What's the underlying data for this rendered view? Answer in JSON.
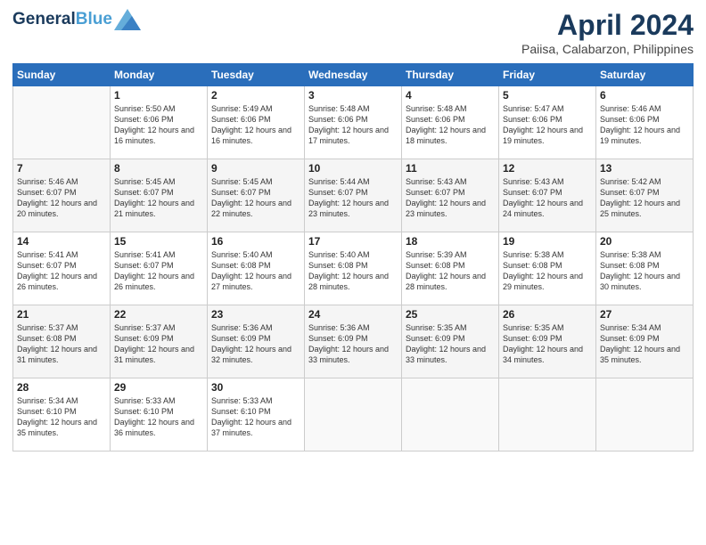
{
  "header": {
    "logo_line1": "General",
    "logo_line2": "Blue",
    "month_title": "April 2024",
    "location": "Paiisa, Calabarzon, Philippines"
  },
  "weekdays": [
    "Sunday",
    "Monday",
    "Tuesday",
    "Wednesday",
    "Thursday",
    "Friday",
    "Saturday"
  ],
  "weeks": [
    [
      {
        "day": "",
        "sunrise": "",
        "sunset": "",
        "daylight": ""
      },
      {
        "day": "1",
        "sunrise": "Sunrise: 5:50 AM",
        "sunset": "Sunset: 6:06 PM",
        "daylight": "Daylight: 12 hours and 16 minutes."
      },
      {
        "day": "2",
        "sunrise": "Sunrise: 5:49 AM",
        "sunset": "Sunset: 6:06 PM",
        "daylight": "Daylight: 12 hours and 16 minutes."
      },
      {
        "day": "3",
        "sunrise": "Sunrise: 5:48 AM",
        "sunset": "Sunset: 6:06 PM",
        "daylight": "Daylight: 12 hours and 17 minutes."
      },
      {
        "day": "4",
        "sunrise": "Sunrise: 5:48 AM",
        "sunset": "Sunset: 6:06 PM",
        "daylight": "Daylight: 12 hours and 18 minutes."
      },
      {
        "day": "5",
        "sunrise": "Sunrise: 5:47 AM",
        "sunset": "Sunset: 6:06 PM",
        "daylight": "Daylight: 12 hours and 19 minutes."
      },
      {
        "day": "6",
        "sunrise": "Sunrise: 5:46 AM",
        "sunset": "Sunset: 6:06 PM",
        "daylight": "Daylight: 12 hours and 19 minutes."
      }
    ],
    [
      {
        "day": "7",
        "sunrise": "Sunrise: 5:46 AM",
        "sunset": "Sunset: 6:07 PM",
        "daylight": "Daylight: 12 hours and 20 minutes."
      },
      {
        "day": "8",
        "sunrise": "Sunrise: 5:45 AM",
        "sunset": "Sunset: 6:07 PM",
        "daylight": "Daylight: 12 hours and 21 minutes."
      },
      {
        "day": "9",
        "sunrise": "Sunrise: 5:45 AM",
        "sunset": "Sunset: 6:07 PM",
        "daylight": "Daylight: 12 hours and 22 minutes."
      },
      {
        "day": "10",
        "sunrise": "Sunrise: 5:44 AM",
        "sunset": "Sunset: 6:07 PM",
        "daylight": "Daylight: 12 hours and 23 minutes."
      },
      {
        "day": "11",
        "sunrise": "Sunrise: 5:43 AM",
        "sunset": "Sunset: 6:07 PM",
        "daylight": "Daylight: 12 hours and 23 minutes."
      },
      {
        "day": "12",
        "sunrise": "Sunrise: 5:43 AM",
        "sunset": "Sunset: 6:07 PM",
        "daylight": "Daylight: 12 hours and 24 minutes."
      },
      {
        "day": "13",
        "sunrise": "Sunrise: 5:42 AM",
        "sunset": "Sunset: 6:07 PM",
        "daylight": "Daylight: 12 hours and 25 minutes."
      }
    ],
    [
      {
        "day": "14",
        "sunrise": "Sunrise: 5:41 AM",
        "sunset": "Sunset: 6:07 PM",
        "daylight": "Daylight: 12 hours and 26 minutes."
      },
      {
        "day": "15",
        "sunrise": "Sunrise: 5:41 AM",
        "sunset": "Sunset: 6:07 PM",
        "daylight": "Daylight: 12 hours and 26 minutes."
      },
      {
        "day": "16",
        "sunrise": "Sunrise: 5:40 AM",
        "sunset": "Sunset: 6:08 PM",
        "daylight": "Daylight: 12 hours and 27 minutes."
      },
      {
        "day": "17",
        "sunrise": "Sunrise: 5:40 AM",
        "sunset": "Sunset: 6:08 PM",
        "daylight": "Daylight: 12 hours and 28 minutes."
      },
      {
        "day": "18",
        "sunrise": "Sunrise: 5:39 AM",
        "sunset": "Sunset: 6:08 PM",
        "daylight": "Daylight: 12 hours and 28 minutes."
      },
      {
        "day": "19",
        "sunrise": "Sunrise: 5:38 AM",
        "sunset": "Sunset: 6:08 PM",
        "daylight": "Daylight: 12 hours and 29 minutes."
      },
      {
        "day": "20",
        "sunrise": "Sunrise: 5:38 AM",
        "sunset": "Sunset: 6:08 PM",
        "daylight": "Daylight: 12 hours and 30 minutes."
      }
    ],
    [
      {
        "day": "21",
        "sunrise": "Sunrise: 5:37 AM",
        "sunset": "Sunset: 6:08 PM",
        "daylight": "Daylight: 12 hours and 31 minutes."
      },
      {
        "day": "22",
        "sunrise": "Sunrise: 5:37 AM",
        "sunset": "Sunset: 6:09 PM",
        "daylight": "Daylight: 12 hours and 31 minutes."
      },
      {
        "day": "23",
        "sunrise": "Sunrise: 5:36 AM",
        "sunset": "Sunset: 6:09 PM",
        "daylight": "Daylight: 12 hours and 32 minutes."
      },
      {
        "day": "24",
        "sunrise": "Sunrise: 5:36 AM",
        "sunset": "Sunset: 6:09 PM",
        "daylight": "Daylight: 12 hours and 33 minutes."
      },
      {
        "day": "25",
        "sunrise": "Sunrise: 5:35 AM",
        "sunset": "Sunset: 6:09 PM",
        "daylight": "Daylight: 12 hours and 33 minutes."
      },
      {
        "day": "26",
        "sunrise": "Sunrise: 5:35 AM",
        "sunset": "Sunset: 6:09 PM",
        "daylight": "Daylight: 12 hours and 34 minutes."
      },
      {
        "day": "27",
        "sunrise": "Sunrise: 5:34 AM",
        "sunset": "Sunset: 6:09 PM",
        "daylight": "Daylight: 12 hours and 35 minutes."
      }
    ],
    [
      {
        "day": "28",
        "sunrise": "Sunrise: 5:34 AM",
        "sunset": "Sunset: 6:10 PM",
        "daylight": "Daylight: 12 hours and 35 minutes."
      },
      {
        "day": "29",
        "sunrise": "Sunrise: 5:33 AM",
        "sunset": "Sunset: 6:10 PM",
        "daylight": "Daylight: 12 hours and 36 minutes."
      },
      {
        "day": "30",
        "sunrise": "Sunrise: 5:33 AM",
        "sunset": "Sunset: 6:10 PM",
        "daylight": "Daylight: 12 hours and 37 minutes."
      },
      {
        "day": "",
        "sunrise": "",
        "sunset": "",
        "daylight": ""
      },
      {
        "day": "",
        "sunrise": "",
        "sunset": "",
        "daylight": ""
      },
      {
        "day": "",
        "sunrise": "",
        "sunset": "",
        "daylight": ""
      },
      {
        "day": "",
        "sunrise": "",
        "sunset": "",
        "daylight": ""
      }
    ]
  ]
}
